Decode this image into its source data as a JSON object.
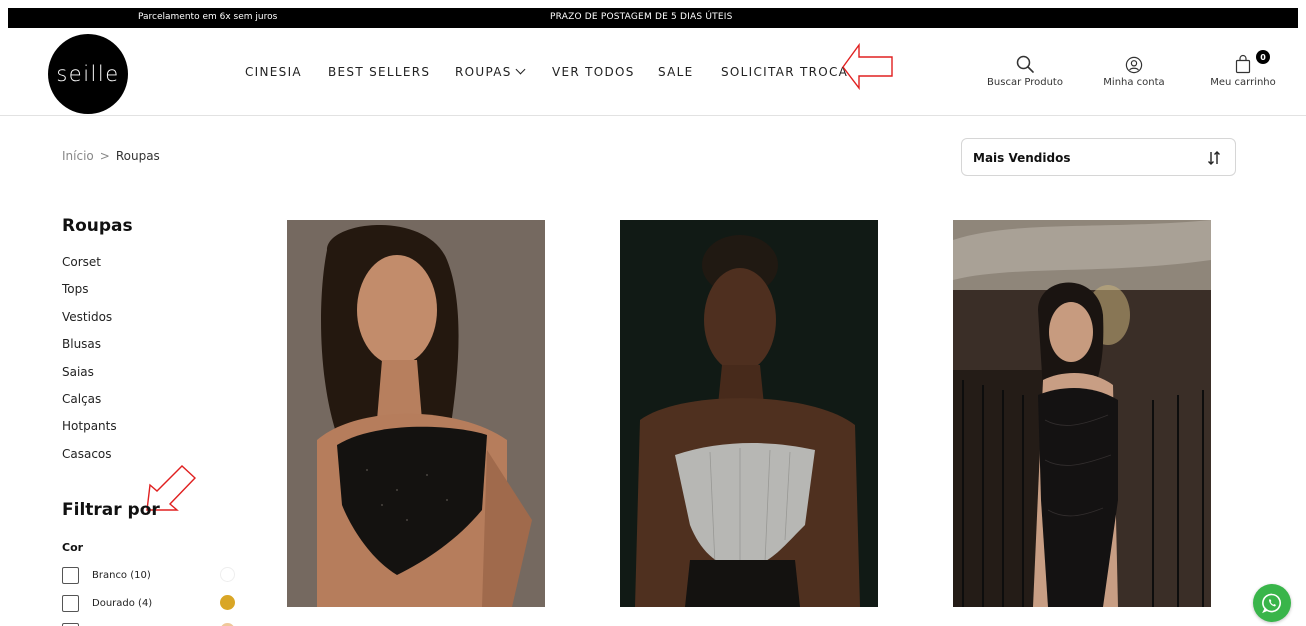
{
  "topbar": {
    "left_message": "Parcelamento em 6x sem juros",
    "center_message": "PRAZO DE POSTAGEM DE 5 DIAS ÚTEIS"
  },
  "logo": {
    "text": "seille"
  },
  "nav": [
    {
      "label": "CINESIA"
    },
    {
      "label": "BEST SELLERS"
    },
    {
      "label": "ROUPAS"
    },
    {
      "label": "VER TODOS"
    },
    {
      "label": "SALE"
    },
    {
      "label": "SOLICITAR TROCA"
    }
  ],
  "header_actions": {
    "search_label": "Buscar Produto",
    "account_label": "Minha conta",
    "cart_label": "Meu carrinho",
    "cart_count": "0"
  },
  "breadcrumb": {
    "home": "Início",
    "separator": ">",
    "current": "Roupas"
  },
  "sort": {
    "selected": "Mais Vendidos"
  },
  "sidebar": {
    "title": "Roupas",
    "categories": [
      "Corset",
      "Tops",
      "Vestidos",
      "Blusas",
      "Saias",
      "Calças",
      "Hotpants",
      "Casacos"
    ],
    "filter_title": "Filtrar por",
    "color_heading": "Cor",
    "color_options": [
      {
        "label": "Branco (10)",
        "color": "#ffffff"
      },
      {
        "label": "Dourado (4)",
        "color": "#d9a626"
      }
    ]
  },
  "colors": {
    "topbar_bg": "#000000",
    "whatsapp_green": "#39b54a",
    "annotation_red": "#e02020"
  },
  "icons": {
    "search": "search-icon",
    "account": "user-circle-icon",
    "cart": "shopping-bag-icon",
    "sort": "sort-arrows-icon",
    "whatsapp": "whatsapp-icon"
  }
}
